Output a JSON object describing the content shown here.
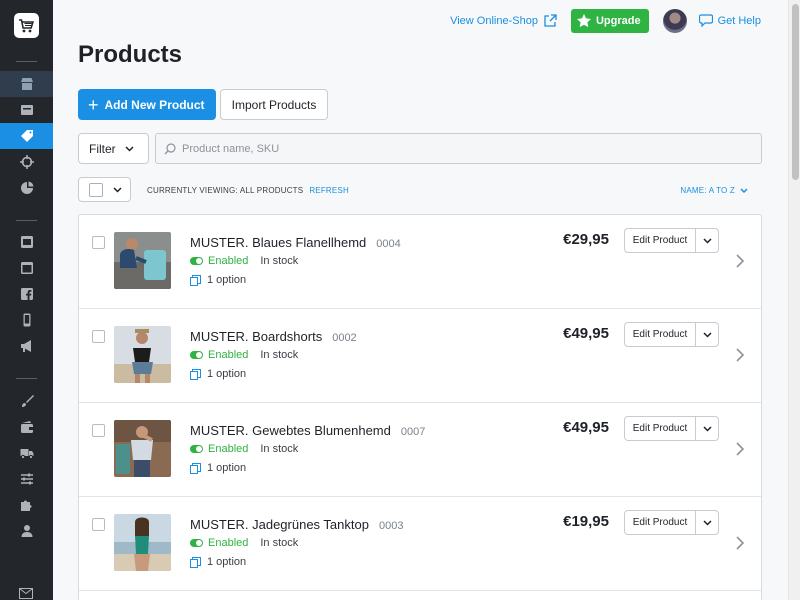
{
  "app": {
    "brand_color": "#1a8fe3",
    "sidebar_bg": "#23262b"
  },
  "sidebar": {
    "logo": "cart-logo-icon",
    "items": [
      {
        "icon": "store-icon",
        "state": "dim"
      },
      {
        "icon": "inbox-icon",
        "state": "normal"
      },
      {
        "icon": "tag-icon",
        "state": "active"
      },
      {
        "icon": "target-icon",
        "state": "normal"
      },
      {
        "icon": "pie-chart-icon",
        "state": "normal"
      },
      {
        "icon": "website-icon",
        "state": "normal"
      },
      {
        "icon": "window-icon",
        "state": "normal"
      },
      {
        "icon": "facebook-icon",
        "state": "normal"
      },
      {
        "icon": "mobile-icon",
        "state": "normal"
      },
      {
        "icon": "megaphone-icon",
        "state": "normal"
      },
      {
        "icon": "brush-icon",
        "state": "normal"
      },
      {
        "icon": "wallet-icon",
        "state": "normal"
      },
      {
        "icon": "truck-icon",
        "state": "normal"
      },
      {
        "icon": "sliders-icon",
        "state": "normal"
      },
      {
        "icon": "puzzle-icon",
        "state": "normal"
      },
      {
        "icon": "user-icon",
        "state": "normal"
      },
      {
        "icon": "mail-icon",
        "state": "normal"
      }
    ]
  },
  "topbar": {
    "view_shop": "View Online-Shop",
    "upgrade": "Upgrade",
    "help": "Get Help"
  },
  "page": {
    "title": "Products",
    "add_button": "Add New Product",
    "import_button": "Import Products",
    "filter": "Filter",
    "search_placeholder": "Product name, SKU",
    "viewing": "CURRENTLY VIEWING: ALL PRODUCTS",
    "refresh": "REFRESH",
    "sort": "NAME: A TO Z"
  },
  "products": [
    {
      "name": "MUSTER. Blaues Flanellhemd",
      "sku": "0004",
      "status": "Enabled",
      "stock": "In stock",
      "options": "1 option",
      "price": "€29,95",
      "edit": "Edit Product"
    },
    {
      "name": "MUSTER. Boardshorts",
      "sku": "0002",
      "status": "Enabled",
      "stock": "In stock",
      "options": "1 option",
      "price": "€49,95",
      "edit": "Edit Product"
    },
    {
      "name": "MUSTER. Gewebtes Blumenhemd",
      "sku": "0007",
      "status": "Enabled",
      "stock": "In stock",
      "options": "1 option",
      "price": "€49,95",
      "edit": "Edit Product"
    },
    {
      "name": "MUSTER. Jadegrünes Tanktop",
      "sku": "0003",
      "status": "Enabled",
      "stock": "In stock",
      "options": "1 option",
      "price": "€19,95",
      "edit": "Edit Product"
    }
  ]
}
